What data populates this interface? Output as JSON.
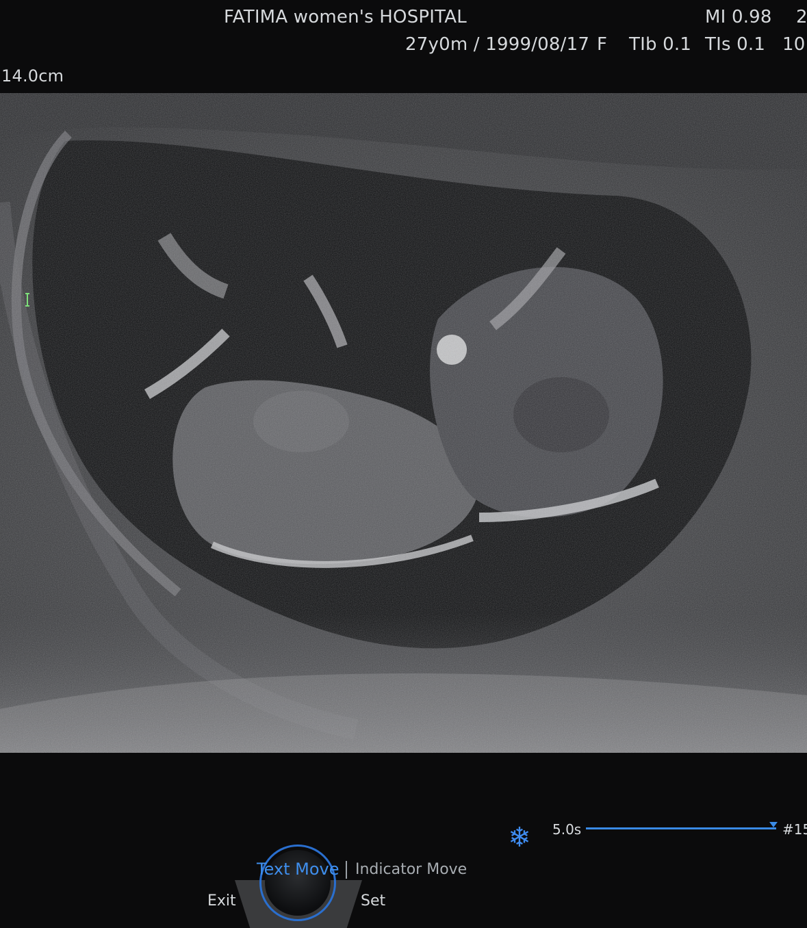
{
  "header": {
    "hospital": "FATIMA women's HOSPITAL",
    "mi": "MI  0.98",
    "mi_extra": "2",
    "patient": "27y0m / 1999/08/17",
    "sex": "F",
    "tib": "TIb 0.1",
    "tis": "TIs 0.1",
    "tis_extra": "10"
  },
  "depth": "14.0cm",
  "cine": {
    "time": "5.0s",
    "frame": "#15",
    "position": 1.0
  },
  "controls": {
    "text_move": "Text Move",
    "indicator_move": "Indicator Move",
    "exit": "Exit",
    "set": "Set"
  },
  "colors": {
    "accent": "#3f8fee",
    "focus_marker": "#7ee07a"
  },
  "icons": {
    "freeze": "snowflake-icon"
  }
}
